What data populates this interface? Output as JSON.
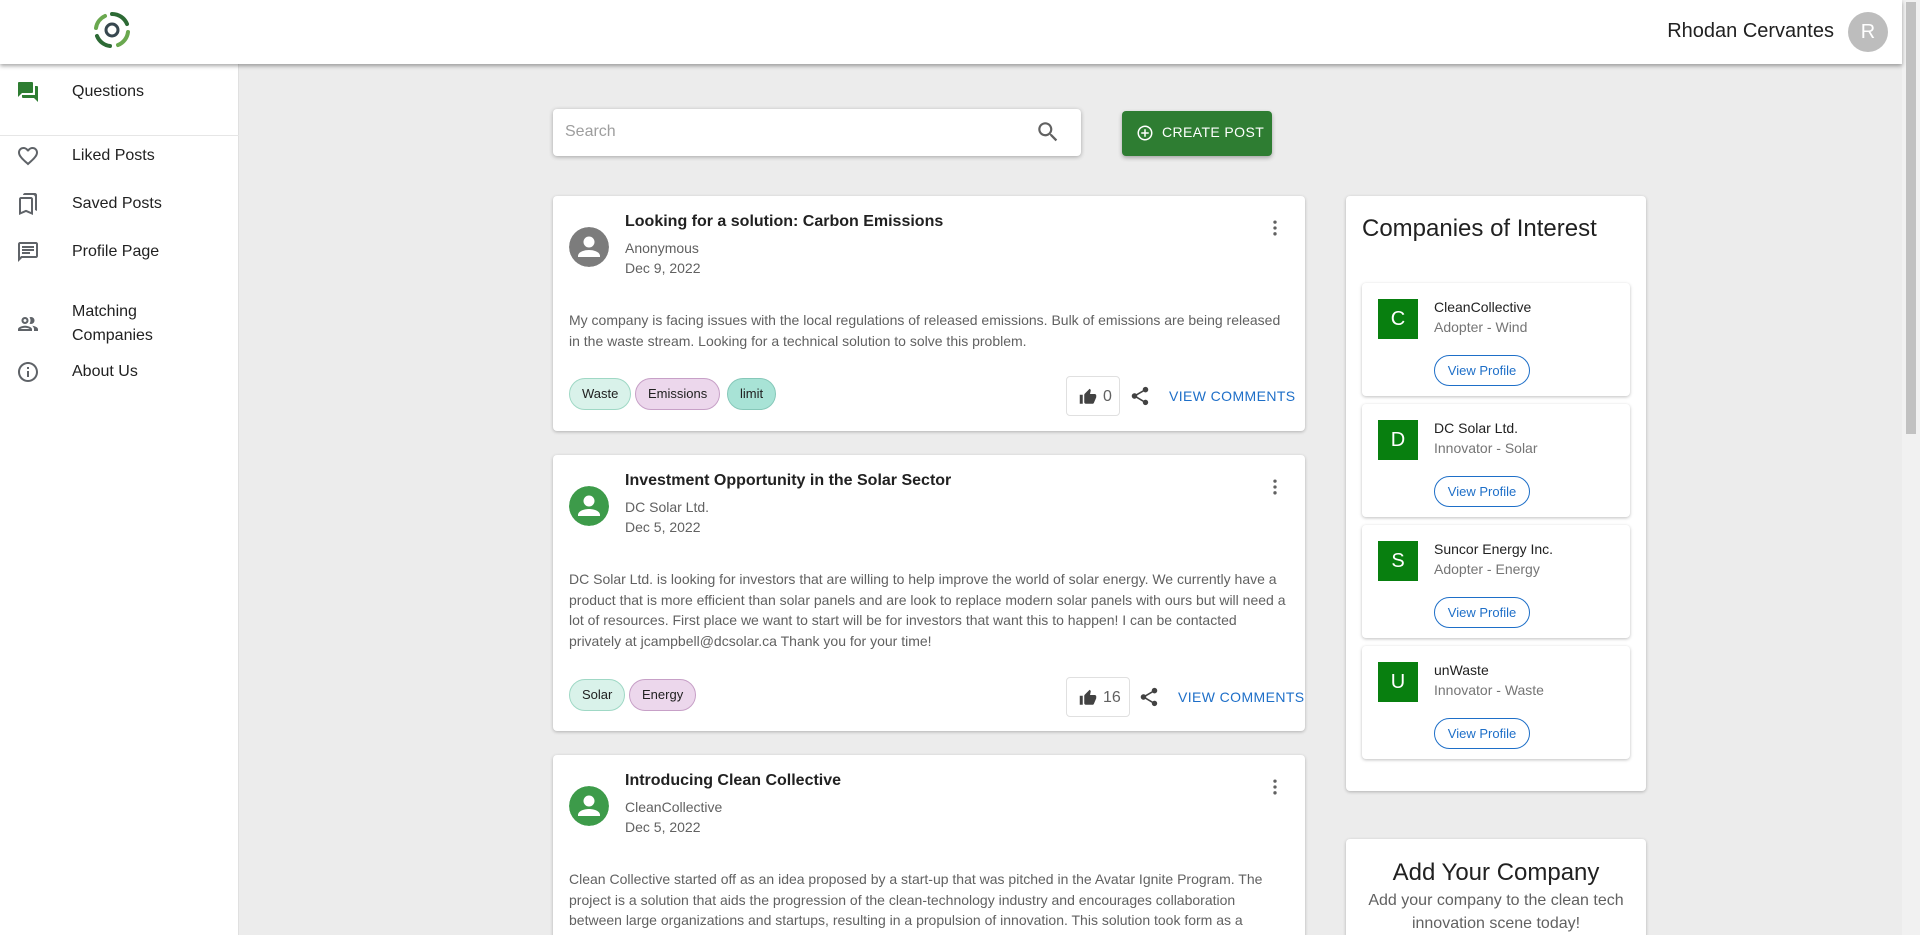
{
  "header": {
    "user_name": "Rhodan Cervantes",
    "user_initial": "R"
  },
  "sidebar": {
    "items": [
      {
        "label": "Questions",
        "icon": "forum-icon"
      },
      {
        "label": "Liked Posts",
        "icon": "heart-icon"
      },
      {
        "label": "Saved Posts",
        "icon": "bookmarks-icon"
      },
      {
        "label": "Profile Page",
        "icon": "article-icon"
      },
      {
        "label": "Matching Companies",
        "icon": "people-icon"
      },
      {
        "label": "About Us",
        "icon": "info-icon"
      }
    ]
  },
  "search": {
    "placeholder": "Search",
    "value": ""
  },
  "create_post": {
    "label": "CREATE POST"
  },
  "posts": [
    {
      "title": "Looking for a solution: Carbon Emissions",
      "author": "Anonymous",
      "date": "Dec 9, 2022",
      "body": "My company is facing issues with the local regulations of released emissions. Bulk of emissions are being released in the waste stream. Looking for a technical solution to solve this problem.",
      "tags": [
        "Waste",
        "Emissions",
        "limit"
      ],
      "likes": "0",
      "comments_label": "VIEW COMMENTS"
    },
    {
      "title": "Investment Opportunity in the Solar Sector",
      "author": "DC Solar Ltd.",
      "date": "Dec 5, 2022",
      "body": "DC Solar Ltd. is looking for investors that are willing to help improve the world of solar energy. We currently have a product that is more efficient than solar panels and are look to replace modern solar panels with ours but will need a lot of resources. First place we want to start will be for investors that want this to happen! I can be contacted privately at jcampbell@dcsolar.ca Thank you for your time!",
      "tags": [
        "Solar",
        "Energy"
      ],
      "likes": "16",
      "comments_label": "VIEW COMMENTS"
    },
    {
      "title": "Introducing Clean Collective",
      "author": "CleanCollective",
      "date": "Dec 5, 2022",
      "body": "Clean Collective started off as an idea proposed by a start-up that was pitched in the Avatar Ignite Program. The project is a solution that aids the progression of the clean-technology industry and encourages collaboration between large organizations and startups, resulting in a propulsion of innovation. This solution took form as a forum-based web application to act as a platform for clean-tech companies to interact."
    }
  ],
  "companies": {
    "title": "Companies of Interest",
    "view_label": "View Profile",
    "items": [
      {
        "initial": "C",
        "name": "CleanCollective",
        "role": "Adopter - Wind"
      },
      {
        "initial": "D",
        "name": "DC Solar Ltd.",
        "role": "Innovator - Solar"
      },
      {
        "initial": "S",
        "name": "Suncor Energy Inc.",
        "role": "Adopter - Energy"
      },
      {
        "initial": "U",
        "name": "unWaste",
        "role": "Innovator - Waste"
      }
    ]
  },
  "add_company": {
    "title": "Add Your Company",
    "subtitle": "Add your company to the clean tech innovation scene today!"
  },
  "colors": {
    "primary_green": "#2e7d32",
    "company_green": "#087f0f",
    "link_blue": "#1e6fc8",
    "post_avatar_green": "#3d9b4a",
    "anon_avatar_gray": "#7c7c7c"
  }
}
